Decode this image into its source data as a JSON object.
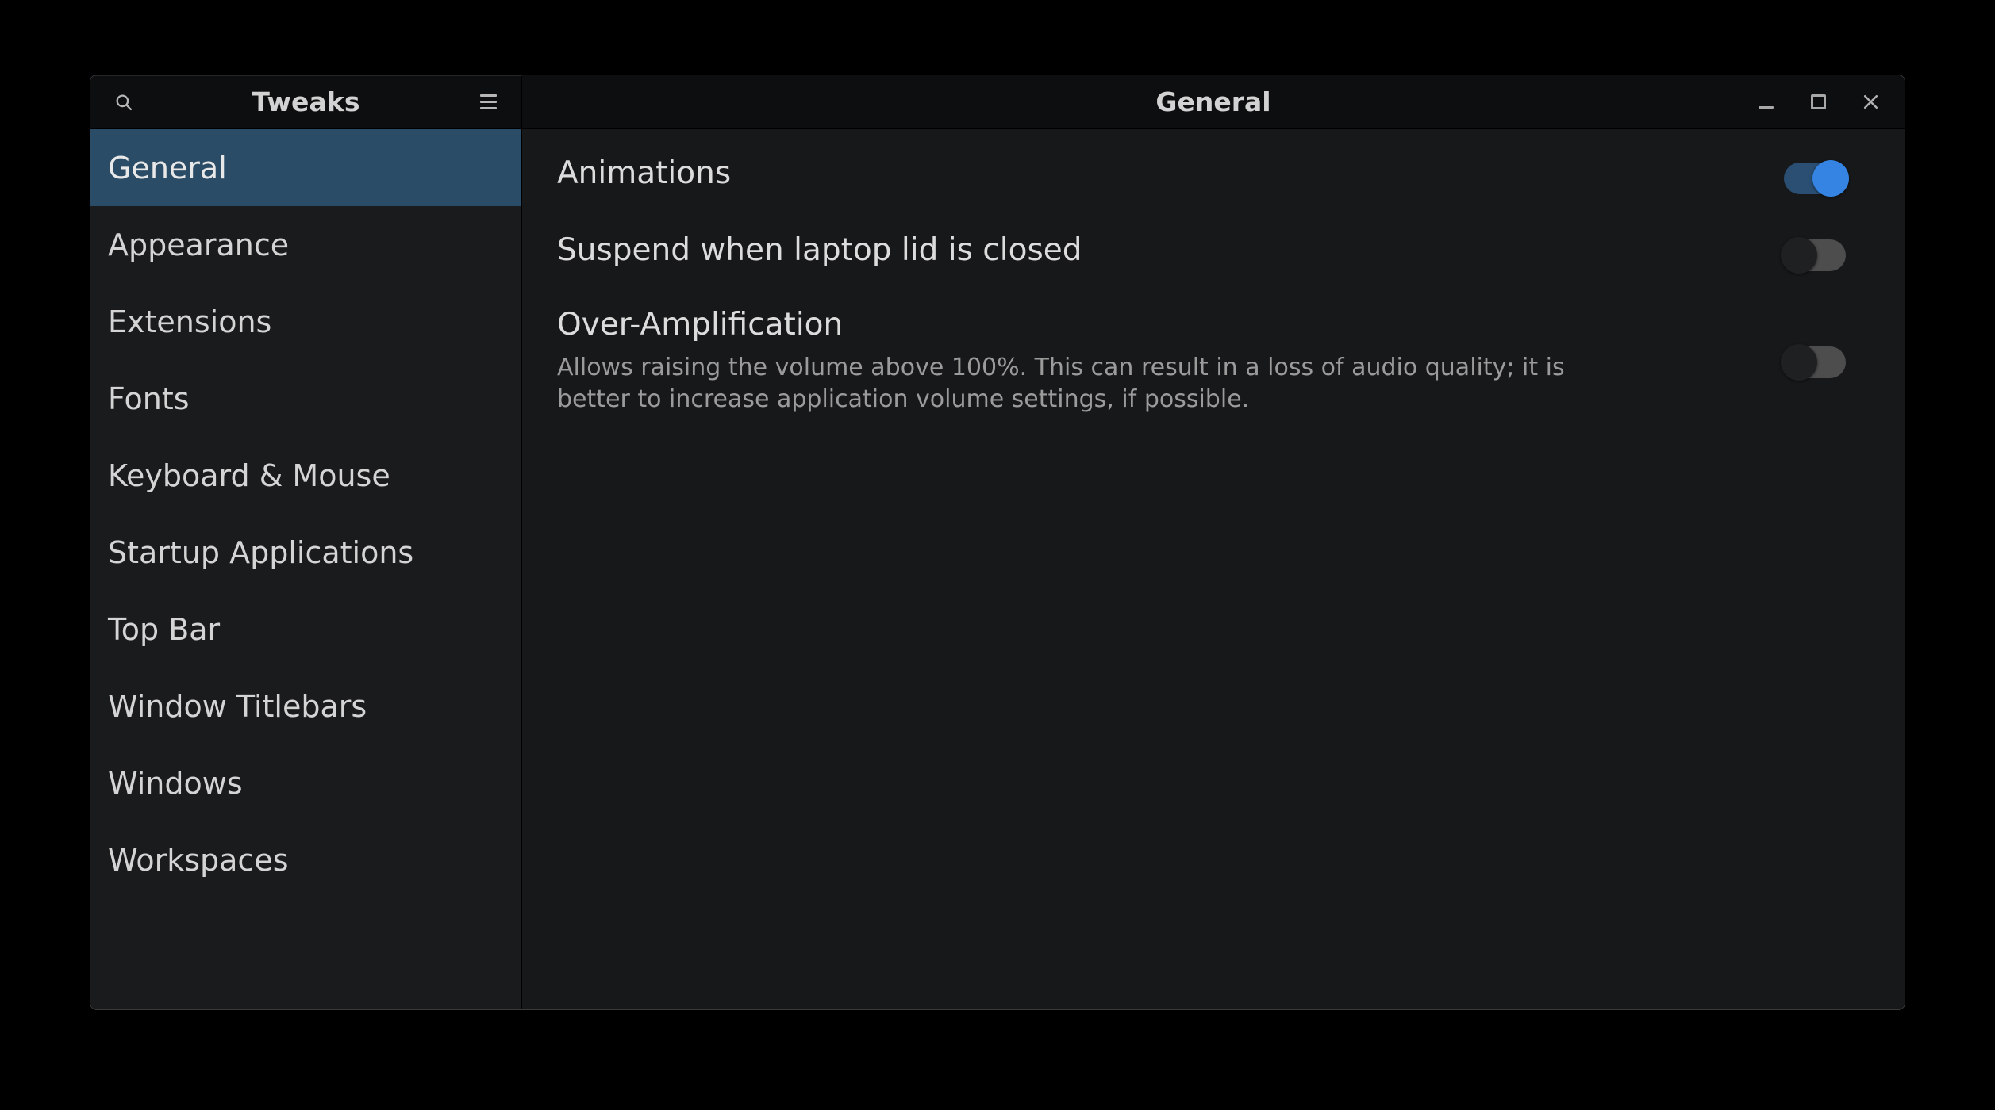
{
  "window": {
    "app_title": "Tweaks",
    "page_title": "General",
    "search_icon": "search-icon",
    "menu_icon": "hamburger-menu-icon",
    "controls": {
      "minimize": "minimize-icon",
      "maximize": "maximize-icon",
      "close": "close-icon"
    }
  },
  "sidebar": {
    "items": [
      {
        "label": "General",
        "selected": true
      },
      {
        "label": "Appearance",
        "selected": false
      },
      {
        "label": "Extensions",
        "selected": false
      },
      {
        "label": "Fonts",
        "selected": false
      },
      {
        "label": "Keyboard & Mouse",
        "selected": false
      },
      {
        "label": "Startup Applications",
        "selected": false
      },
      {
        "label": "Top Bar",
        "selected": false
      },
      {
        "label": "Window Titlebars",
        "selected": false
      },
      {
        "label": "Windows",
        "selected": false
      },
      {
        "label": "Workspaces",
        "selected": false
      }
    ]
  },
  "settings": [
    {
      "label": "Animations",
      "description": "",
      "state": "on"
    },
    {
      "label": "Suspend when laptop lid is closed",
      "description": "",
      "state": "off"
    },
    {
      "label": "Over-Amplification",
      "description": "Allows raising the volume above 100%. This can result in a loss of audio quality; it is better to increase application volume settings, if possible.",
      "state": "off"
    }
  ],
  "colors": {
    "accent": "#3584e4",
    "accent_track": "#2a4f73",
    "selection": "#2b4c66",
    "sidebar_bg": "#1a1b1d",
    "content_bg": "#17181a",
    "header_bg": "#0d0e0f",
    "label_text": "#dcdcdc",
    "desc_text": "#9b9b9b"
  }
}
